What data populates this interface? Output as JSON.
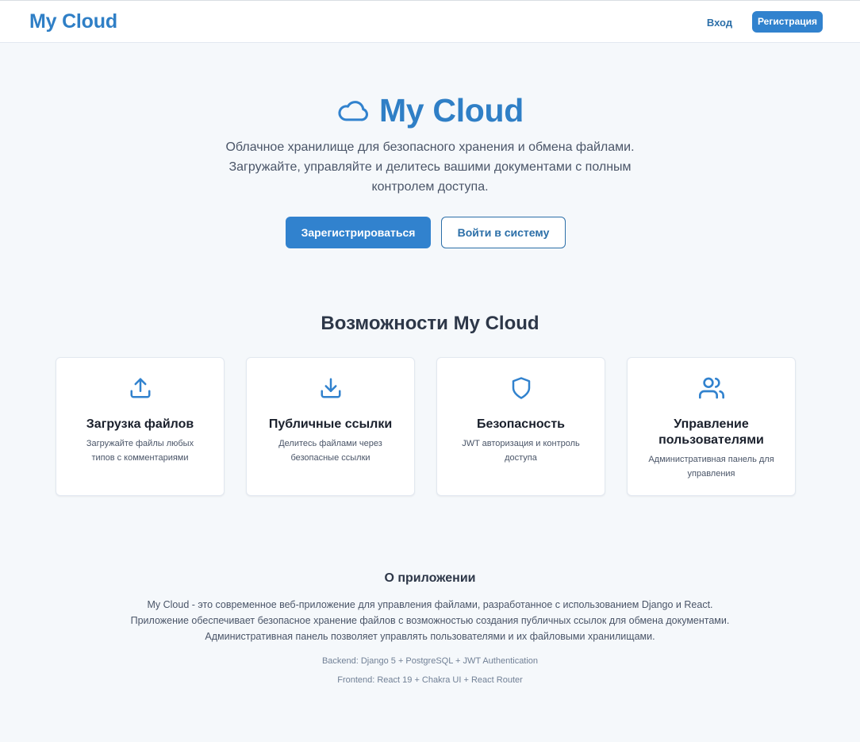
{
  "header": {
    "brand": "My Cloud",
    "login_label": "Вход",
    "register_label": "Регистрация"
  },
  "hero": {
    "icon": "cloud-icon",
    "title": "My Cloud",
    "description": "Облачное хранилище для безопасного хранения и обмена файлами. Загружайте, управляйте и делитесь вашими документами с полным контролем доступа.",
    "primary_button": "Зарегистрироваться",
    "secondary_button": "Войти в систему"
  },
  "features": {
    "title": "Возможности My Cloud",
    "items": [
      {
        "icon": "upload-icon",
        "title": "Загрузка файлов",
        "description": "Загружайте файлы любых типов с комментариями"
      },
      {
        "icon": "download-icon",
        "title": "Публичные ссылки",
        "description": "Делитесь файлами через безопасные ссылки"
      },
      {
        "icon": "shield-icon",
        "title": "Безопасность",
        "description": "JWT авторизация и контроль доступа"
      },
      {
        "icon": "users-icon",
        "title": "Управление пользователями",
        "description": "Административная панель для управления"
      }
    ]
  },
  "about": {
    "title": "О приложении",
    "text": "My Cloud - это современное веб-приложение для управления файлами, разработанное с использованием Django и React. Приложение обеспечивает безопасное хранение файлов с возможностью создания публичных ссылок для обмена документами. Административная панель позволяет управлять пользователями и их файловыми хранилищами.",
    "backend": "Backend: Django 5 + PostgreSQL + JWT Authentication",
    "frontend": "Frontend: React 19 + Chakra UI + React Router"
  },
  "colors": {
    "accent": "#3182ce",
    "brand_text": "#2f7fc6",
    "background": "#f5f8fb"
  }
}
